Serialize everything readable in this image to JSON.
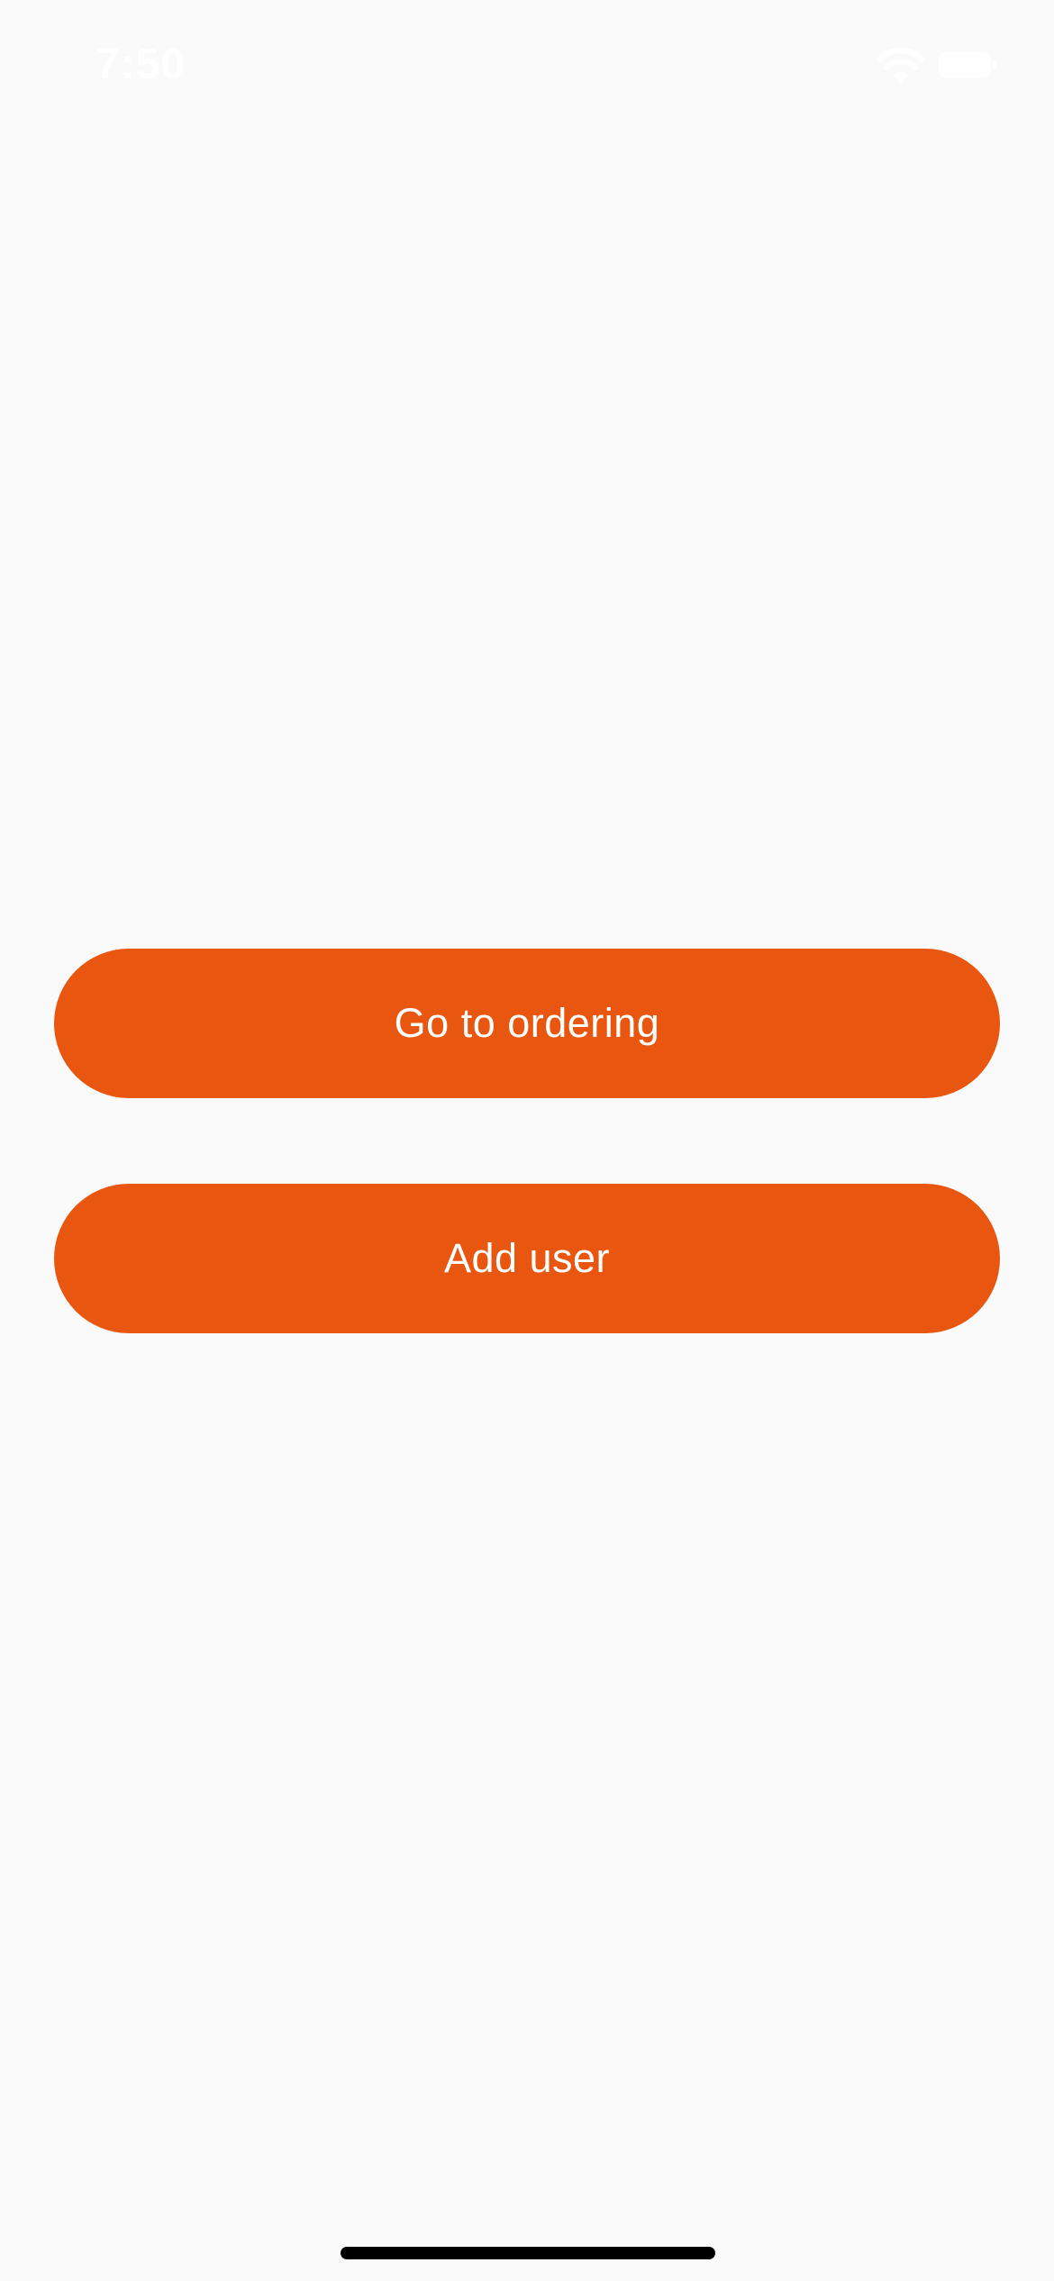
{
  "status_bar": {
    "time": "7:50",
    "wifi_icon": "wifi-icon",
    "battery_icon": "battery-icon"
  },
  "main": {
    "buttons": [
      {
        "label": "Go to ordering"
      },
      {
        "label": "Add user"
      }
    ]
  },
  "colors": {
    "background": "#fafafa",
    "accent": "#e9560f",
    "button_text": "#ffffff"
  }
}
